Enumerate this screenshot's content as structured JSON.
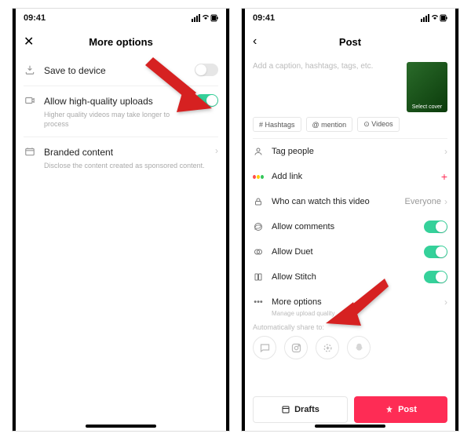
{
  "status": {
    "time": "09:41",
    "icons": "•ıll ⦿ ▮"
  },
  "left": {
    "title": "More options",
    "save": {
      "label": "Save to device"
    },
    "hq": {
      "label": "Allow high-quality uploads",
      "sub": "Higher quality videos may take longer to process"
    },
    "branded": {
      "label": "Branded content",
      "sub": "Disclose the content created as sponsored content."
    }
  },
  "right": {
    "title": "Post",
    "caption_placeholder": "Add a caption, hashtags, tags, etc.",
    "cover_label": "Select cover",
    "chips": {
      "hashtags": "# Hashtags",
      "mention": "@ mention",
      "videos": "⊙ Videos"
    },
    "tag_people": "Tag people",
    "add_link": "Add link",
    "who": {
      "label": "Who can watch this video",
      "value": "Everyone"
    },
    "comments": "Allow comments",
    "duet": "Allow Duet",
    "stitch": "Allow Stitch",
    "more": {
      "label": "More options",
      "sub": "Manage upload quality"
    },
    "share_label": "Automatically share to:",
    "drafts": "Drafts",
    "post": "Post"
  }
}
